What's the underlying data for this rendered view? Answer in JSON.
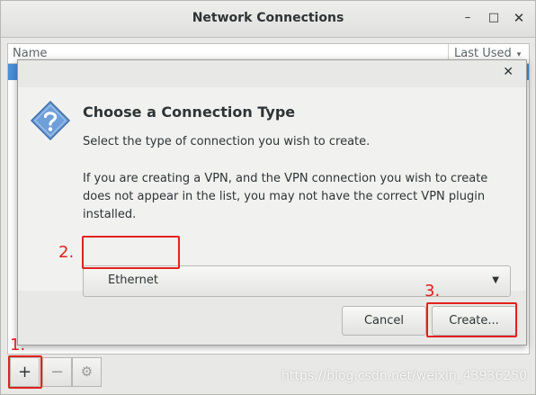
{
  "window": {
    "title": "Network Connections",
    "buttons": {
      "minimize": "–",
      "maximize": "□",
      "close": "✕"
    }
  },
  "list": {
    "columns": [
      "Name",
      "Last Used"
    ],
    "sort_indicator": "▾"
  },
  "toolbar": {
    "add": "+",
    "remove": "−",
    "settings": "⚙"
  },
  "dialog": {
    "close": "✕",
    "heading": "Choose a Connection Type",
    "subtitle": "Select the type of connection you wish to create.",
    "paragraph": "If you are creating a VPN, and the VPN connection you wish to create does not appear in the list, you may not have the correct VPN plugin installed.",
    "connection_type": {
      "selected": "Ethernet"
    },
    "buttons": {
      "cancel": "Cancel",
      "create": "Create..."
    }
  },
  "annotations": {
    "step1": "1.",
    "step2": "2.",
    "step3": "3."
  },
  "watermark": "https://blog.csdn.net/weixin_43936250",
  "colors": {
    "annotation": "#e2211c",
    "selection": "#4a90d9"
  },
  "icons": {
    "dialog": "question-icon",
    "combo": "caret-down-icon"
  }
}
